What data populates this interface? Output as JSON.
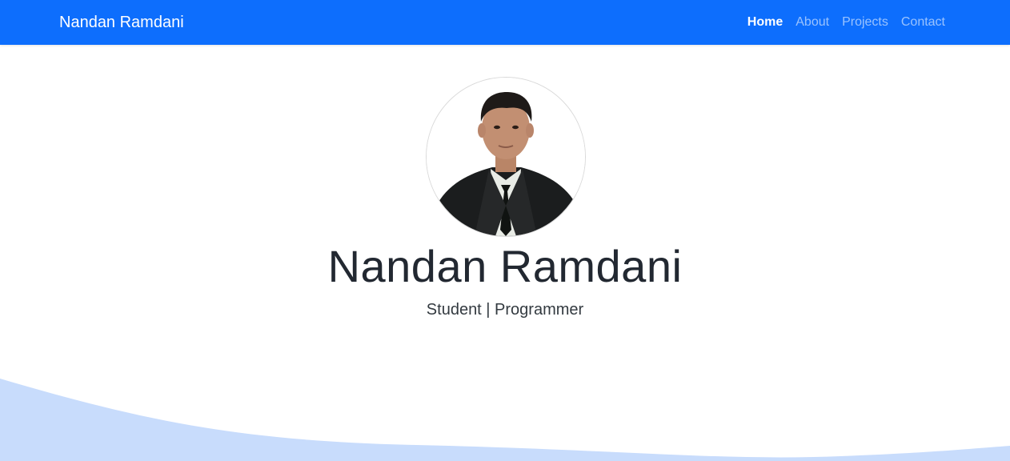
{
  "navbar": {
    "brand": "Nandan Ramdani",
    "links": [
      {
        "label": "Home",
        "active": true
      },
      {
        "label": "About",
        "active": false
      },
      {
        "label": "Projects",
        "active": false
      },
      {
        "label": "Contact",
        "active": false
      }
    ]
  },
  "hero": {
    "name": "Nandan Ramdani",
    "tagline": "Student | Programmer",
    "avatar_alt": "profile-photo"
  },
  "colors": {
    "navbar_bg": "#0d6efd",
    "wave_fill": "#c8dcfc"
  }
}
